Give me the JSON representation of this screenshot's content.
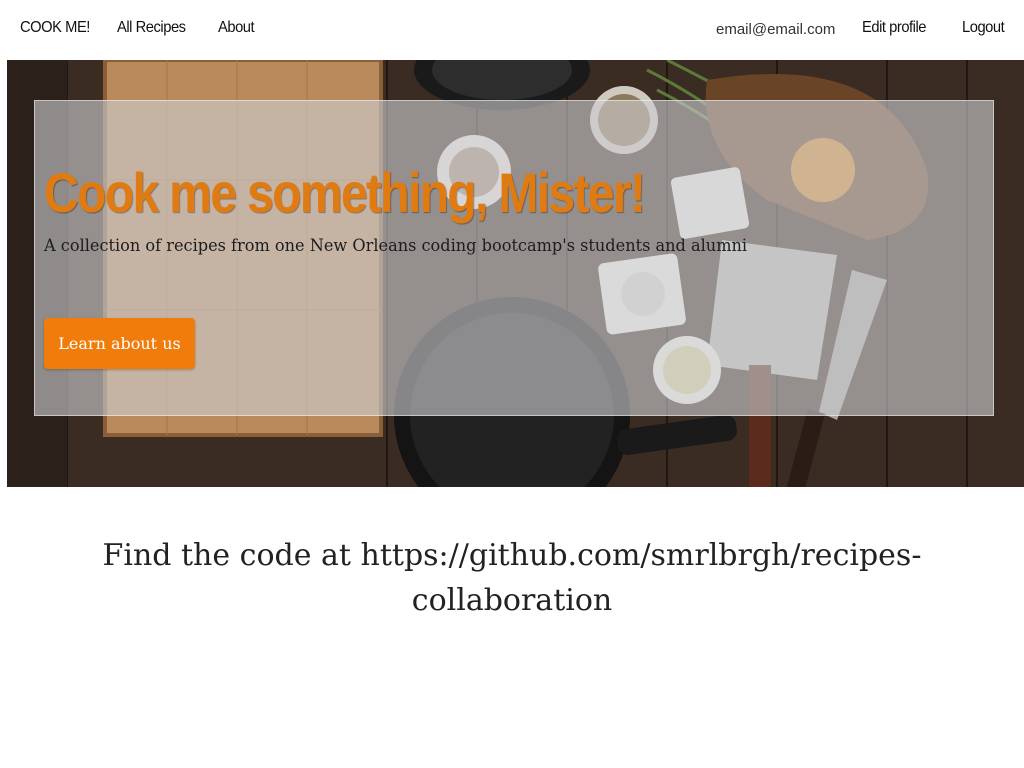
{
  "navbar": {
    "brand": "COOK ME!",
    "links": [
      {
        "label": "All Recipes"
      },
      {
        "label": "About"
      }
    ],
    "user_email": "email@email.com",
    "edit_profile": "Edit profile",
    "logout": "Logout"
  },
  "hero": {
    "title": "Cook me something, Mister!",
    "subtitle": "A collection of recipes from one New Orleans coding bootcamp's students and alumni",
    "button_label": "Learn about us",
    "accent_color": "#f07c0c"
  },
  "footer_note": {
    "line1": "Find the code at https://github.com/smrlbrgh/recipes-",
    "line2": "collaboration"
  }
}
